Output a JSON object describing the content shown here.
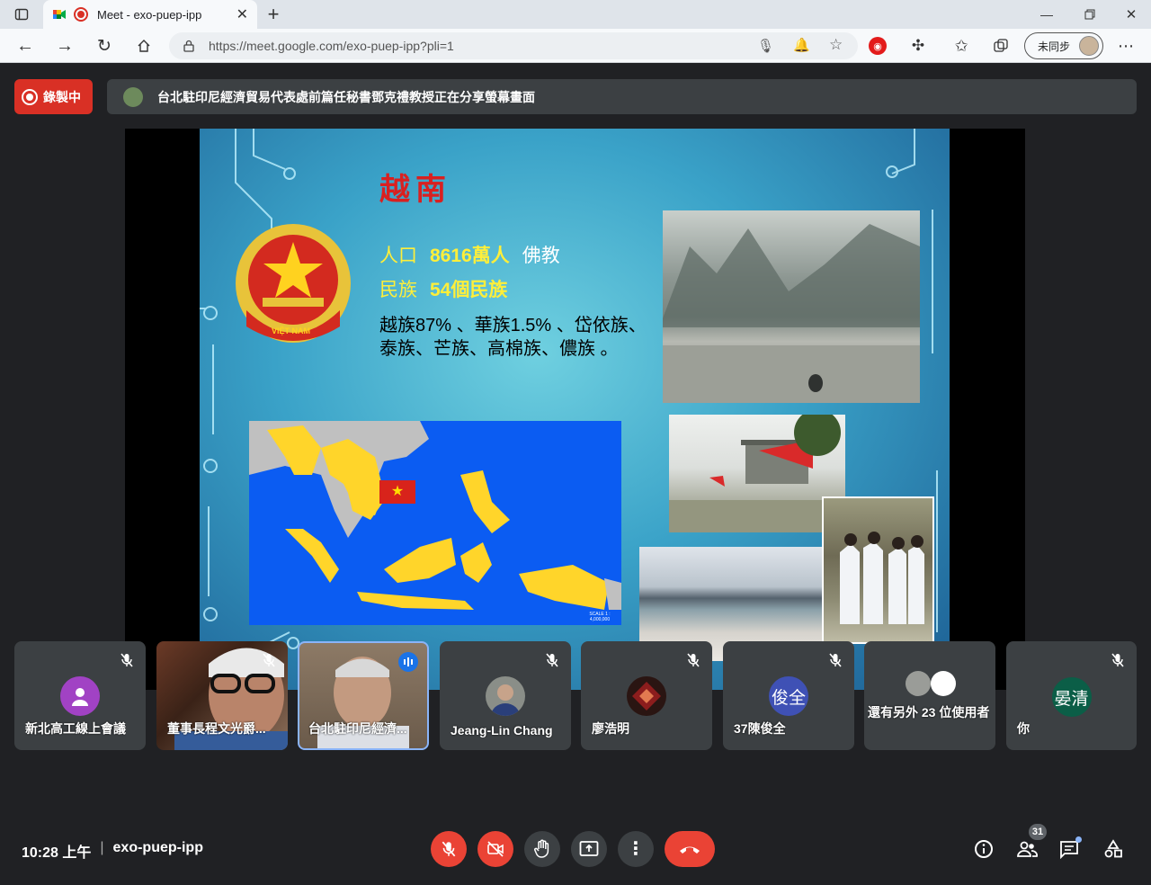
{
  "browser": {
    "tab_title": "Meet - exo-puep-ipp",
    "url": "https://meet.google.com/exo-puep-ipp?pli=1",
    "sync_label": "未同步"
  },
  "meet": {
    "recording_label": "錄製中",
    "presenting_banner": "台北駐印尼經濟貿易代表處前篇任秘書鄧克禮教授正在分享螢幕畫面",
    "time": "10:28 上午",
    "meeting_code": "exo-puep-ipp",
    "participant_count": "31",
    "colors": {
      "red": "#d93025",
      "panel": "#3c4043",
      "bg": "#202124"
    }
  },
  "slide": {
    "title": "越南",
    "line1_label": "人口",
    "line1_value": "8616萬人",
    "line1_extra": "佛教",
    "line2_label": "民族",
    "line2_value": "54個民族",
    "line3": "越族87% 、華族1.5% 、岱依族、",
    "line4": "泰族、芒族、高棉族、儂族 。",
    "emblem_text": "VIỆT NAM",
    "scale_text": "SCALE 1 : 4,000,000"
  },
  "tiles": [
    {
      "name": "新北高工線上會議",
      "avatar": "",
      "color": "#a142c4"
    },
    {
      "name": "董事長程文光爵...",
      "avatar": "",
      "color": ""
    },
    {
      "name": "台北駐印尼經濟...",
      "avatar": "",
      "color": ""
    },
    {
      "name": "Jeang-Lin Chang",
      "avatar": "",
      "color": ""
    },
    {
      "name": "廖浩明",
      "avatar": "",
      "color": ""
    },
    {
      "name": "37陳俊全",
      "avatar": "俊全",
      "color": "#3f51b5"
    },
    {
      "name": "還有另外 23 位使用者",
      "avatar": "",
      "color": ""
    },
    {
      "name": "你",
      "avatar": "晏清",
      "color": "#0b5e47"
    }
  ]
}
